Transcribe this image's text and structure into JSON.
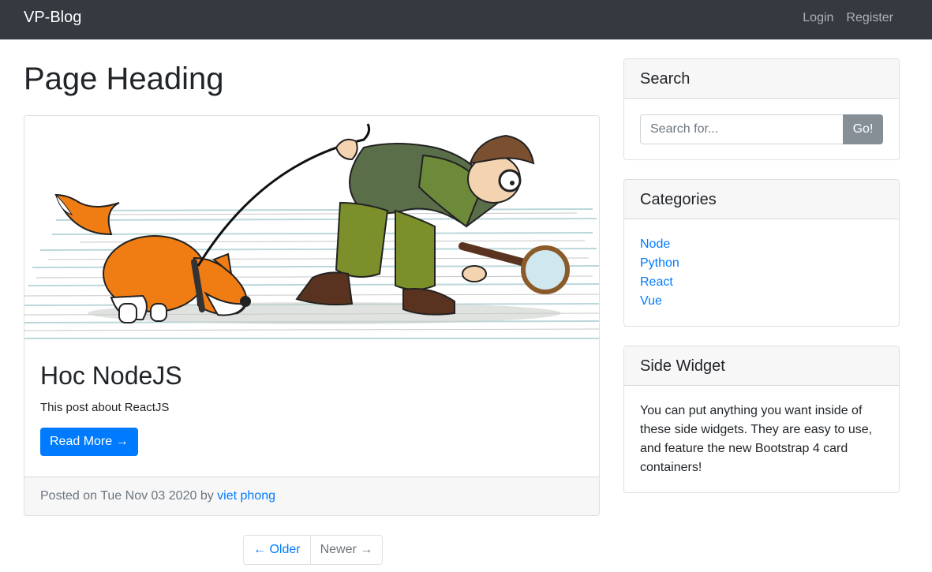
{
  "navbar": {
    "brand": "VP-Blog",
    "links": [
      "Login",
      "Register"
    ]
  },
  "main": {
    "heading": "Page Heading",
    "posts": [
      {
        "image_alt": "cartoon detective with magnifying glass walking a fox dog over code",
        "title": "Hoc NodeJS",
        "excerpt": "This post about ReactJS",
        "read_more": "Read More →",
        "posted_prefix": "Posted on Tue Nov 03 2020 by ",
        "author": "viet phong"
      }
    ],
    "pagination": {
      "older": "← Older",
      "newer": "Newer →"
    }
  },
  "sidebar": {
    "search": {
      "title": "Search",
      "placeholder": "Search for...",
      "button": "Go!"
    },
    "categories": {
      "title": "Categories",
      "items": [
        "Node",
        "Python",
        "React",
        "Vue"
      ]
    },
    "widget": {
      "title": "Side Widget",
      "text": "You can put anything you want inside of these side widgets. They are easy to use, and feature the new Bootstrap 4 card containers!"
    }
  },
  "colors": {
    "navbar_bg": "#343a40",
    "primary": "#007bff",
    "secondary": "#868e96"
  }
}
